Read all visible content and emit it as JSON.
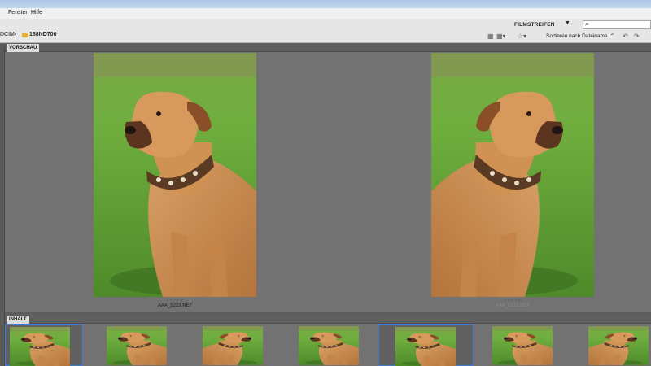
{
  "menu": {
    "items": [
      "Fenster",
      "Hilfe"
    ]
  },
  "toolbar": {
    "workspace": "FILMSTREIFEN",
    "search_placeholder": "",
    "path": [
      "DCIM",
      "188ND700"
    ],
    "sort_label": "Sortieren nach Dateiname"
  },
  "preview": {
    "tab_label": "VORSCHAU",
    "images": [
      {
        "filename": "AAA_5223.NEF",
        "stars": "• • • • •"
      },
      {
        "filename": "AAA_5221.NEF",
        "stars": "• • • • •"
      }
    ]
  },
  "content": {
    "tab_label": "INHALT",
    "thumbnails": [
      {
        "selected": true
      },
      {
        "selected": false
      },
      {
        "selected": false
      },
      {
        "selected": false
      },
      {
        "selected": true
      },
      {
        "selected": false
      },
      {
        "selected": false
      }
    ]
  },
  "colors": {
    "selection": "#3a7fd8",
    "grass": "#6cab3c",
    "dog": "#c98a4a"
  }
}
